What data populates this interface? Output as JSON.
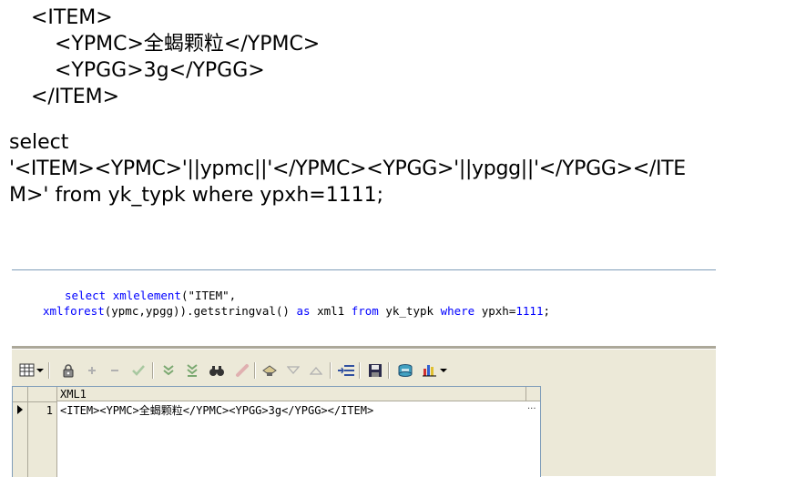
{
  "xml_example": {
    "line1": "<ITEM>",
    "line2": "<YPMC>全蝎颗粒</YPMC>",
    "line3": "<YPGG>3g</YPGG>",
    "line4": "</ITEM>"
  },
  "sql_text": {
    "line1": "select",
    "line2": "'<ITEM><YPMC>'||ypmc||'</YPMC><YPGG>'||ypgg||'</YPGG></ITE",
    "line3": "M>' from yk_typk where ypxh=1111;"
  },
  "code": {
    "l1_kw_select": "select",
    "l1_fn": "xmlelement",
    "l1_rest": "(\"ITEM\",",
    "l2_fn": "xmlforest",
    "l2_args": "(ypmc,ypgg)).getstringval()",
    "l2_kw_as": "as",
    "l2_alias": "xml1",
    "l2_kw_from": "from",
    "l2_table": "yk_typk",
    "l2_kw_where": "where",
    "l2_cond": "ypxh=",
    "l2_num": "1111",
    "l2_end": ";"
  },
  "toolbar": {
    "icons": [
      "grid-view-icon",
      "dropdown-arrow-icon",
      "lock-icon",
      "add-record-icon",
      "delete-record-icon",
      "post-changes-icon",
      "fetch-next-page-icon",
      "fetch-last-page-icon",
      "find-icon",
      "clear-icon",
      "query-by-example-icon",
      "previous-record-icon",
      "next-record-icon",
      "single-record-view-icon",
      "save-icon",
      "export-icon",
      "chart-icon",
      "chart-dropdown-icon"
    ]
  },
  "grid": {
    "column_header": "XML1",
    "rows": [
      {
        "row_number": "1",
        "value": "<ITEM><YPMC>全蝎颗粒</YPMC><YPGG>3g</YPGG></ITEM>",
        "ellipsis": "..."
      }
    ]
  },
  "colors": {
    "keyword": "#0000ff",
    "panel_bg": "#ece9d8",
    "border": "#7f9db9"
  }
}
